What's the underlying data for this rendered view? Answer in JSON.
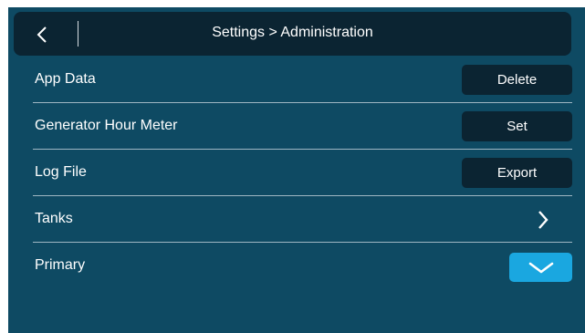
{
  "header": {
    "title": "Settings > Administration"
  },
  "rows": [
    {
      "label": "App Data",
      "action_label": "Delete"
    },
    {
      "label": "Generator Hour Meter",
      "action_label": "Set"
    },
    {
      "label": "Log File",
      "action_label": "Export"
    },
    {
      "label": "Tanks"
    },
    {
      "label": "Primary",
      "checked": true
    }
  ],
  "colors": {
    "background": "#0e4a63",
    "header_bg": "#0b2432",
    "button_bg": "#0b2432",
    "accent": "#1aa7e0",
    "divider": "#9fb7c3",
    "text": "#ffffff"
  },
  "icons": {
    "back": "chevron-left-icon",
    "tanks": "chevron-right-icon",
    "primary": "checkmark-icon"
  }
}
